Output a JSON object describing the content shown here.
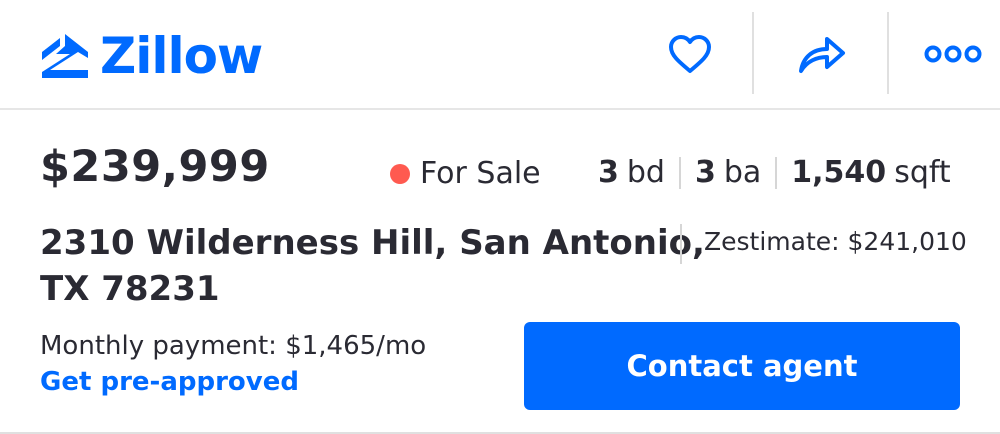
{
  "header": {
    "brand": "Zillow",
    "save_icon": "heart-icon",
    "share_icon": "share-arrow-icon",
    "more_icon": "more-dots-icon",
    "accent_color": "#006aff"
  },
  "listing": {
    "price": "$239,999",
    "status": {
      "label": "For Sale",
      "dot_color": "#ff5a50"
    },
    "facts": [
      {
        "value": "3",
        "unit": "bd"
      },
      {
        "value": "3",
        "unit": "ba"
      },
      {
        "value": "1,540",
        "unit": "sqft"
      }
    ],
    "address_line1": "2310 Wilderness Hill, San Antonio,",
    "address_line2": "TX 78231",
    "zestimate": "Zestimate: $241,010",
    "monthly_payment": "Monthly payment: $1,465/mo",
    "preapproved_link": "Get pre-approved",
    "contact_button": "Contact agent"
  }
}
